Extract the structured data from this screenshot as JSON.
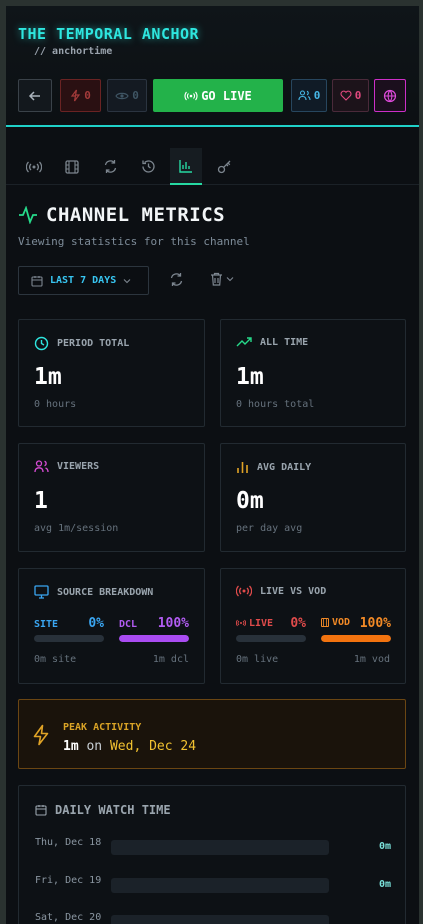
{
  "header": {
    "title": "THE TEMPORAL ANCHOR",
    "subtitle": "// anchortime"
  },
  "toolbar": {
    "flash_count": "0",
    "eye_count": "0",
    "go_live_label": "GO LIVE",
    "users_count": "0",
    "heart_count": "0"
  },
  "tabs": [
    {
      "icon": "broadcast-icon"
    },
    {
      "icon": "film-icon"
    },
    {
      "icon": "refresh-icon"
    },
    {
      "icon": "history-icon"
    },
    {
      "icon": "bar-chart-icon",
      "active": true
    },
    {
      "icon": "key-icon"
    }
  ],
  "section": {
    "title": "CHANNEL METRICS",
    "subtitle": "Viewing statistics for this channel"
  },
  "range": {
    "label": "LAST 7 DAYS"
  },
  "cards": {
    "period_total": {
      "label": "PERIOD TOTAL",
      "value": "1m",
      "note": "0 hours"
    },
    "all_time": {
      "label": "ALL TIME",
      "value": "1m",
      "note": "0 hours total"
    },
    "viewers": {
      "label": "VIEWERS",
      "value": "1",
      "note": "avg 1m/session"
    },
    "avg_daily": {
      "label": "AVG DAILY",
      "value": "0m",
      "note": "per day avg"
    }
  },
  "source_breakdown": {
    "label": "SOURCE BREAKDOWN",
    "site_label": "SITE",
    "site_pct": "0%",
    "site_value": 0,
    "dcl_label": "DCL",
    "dcl_pct": "100%",
    "dcl_value": 100,
    "left_note": "0m site",
    "right_note": "1m dcl"
  },
  "live_vs_vod": {
    "label": "LIVE VS VOD",
    "live_label": "LIVE",
    "live_pct": "0%",
    "live_value": 0,
    "vod_label": "VOD",
    "vod_pct": "100%",
    "vod_value": 100,
    "left_note": "0m live",
    "right_note": "1m vod"
  },
  "peak": {
    "label": "PEAK ACTIVITY",
    "amount": "1m",
    "connector": "on",
    "date": "Wed, Dec 24"
  },
  "daily": {
    "title": "DAILY WATCH TIME",
    "rows": [
      {
        "date": "Thu, Dec 18",
        "value": "0m",
        "fill": 0
      },
      {
        "date": "Fri, Dec 19",
        "value": "0m",
        "fill": 0
      },
      {
        "date": "Sat, Dec 20",
        "value": "",
        "fill": 0
      }
    ]
  },
  "colors": {
    "accent_cyan": "#2ee6df",
    "live_green": "#23b24a",
    "dcl_purple": "#a94cf2",
    "vod_orange": "#f2730f",
    "peak_amber": "#d9a326"
  }
}
